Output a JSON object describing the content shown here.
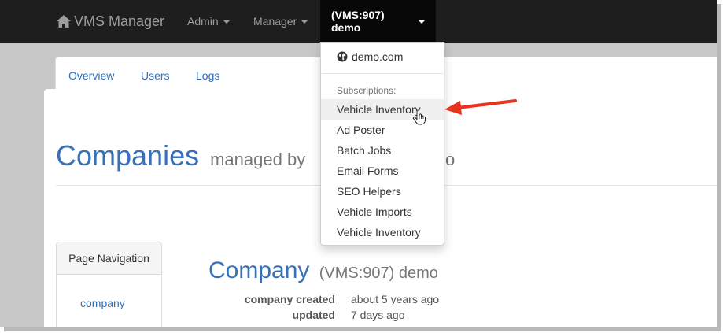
{
  "navbar": {
    "brand": "VMS Manager",
    "items": [
      {
        "label": "Admin"
      },
      {
        "label": "Manager"
      },
      {
        "label": "(VMS:907) demo"
      }
    ]
  },
  "tabs": [
    {
      "label": "Overview"
    },
    {
      "label": "Users"
    },
    {
      "label": "Logs"
    }
  ],
  "heading": {
    "title": "Companies",
    "subtitle": "managed by",
    "subtitle_tail": "o"
  },
  "dropdown": {
    "site": "demo.com",
    "header": "Subscriptions:",
    "items": [
      {
        "label": "Vehicle Inventory"
      },
      {
        "label": "Ad Poster"
      },
      {
        "label": "Batch Jobs"
      },
      {
        "label": "Email Forms"
      },
      {
        "label": "SEO Helpers"
      },
      {
        "label": "Vehicle Imports"
      },
      {
        "label": "Vehicle Inventory"
      }
    ]
  },
  "page_navigation": {
    "title": "Page Navigation",
    "link": "company"
  },
  "company": {
    "title": "Company",
    "subtitle": "(VMS:907) demo",
    "meta": [
      {
        "label": "company created",
        "value": "about 5 years ago"
      },
      {
        "label": "updated",
        "value": "7 days ago"
      }
    ]
  },
  "colors": {
    "navbar_bg": "#1e1e1e",
    "link": "#2f6db5",
    "heading": "#3671b9",
    "annotation_arrow": "#e8341c"
  }
}
